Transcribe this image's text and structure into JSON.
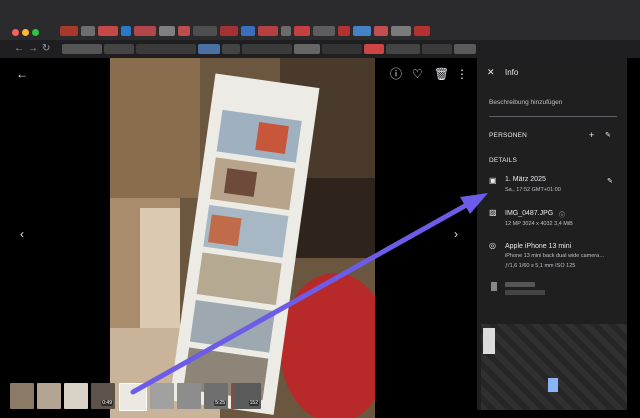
{
  "browser": {
    "nav_back": "←",
    "nav_forward": "→",
    "nav_reload": "↻"
  },
  "viewer": {
    "back_icon": "arrow-left-icon",
    "toolbar_icons": [
      "info-icon",
      "heart-icon",
      "trash-icon",
      "more-icon"
    ],
    "prev_icon": "chevron-left-icon",
    "next_icon": "chevron-right-icon",
    "thumbnails": [
      {
        "badge": ""
      },
      {
        "badge": ""
      },
      {
        "badge": ""
      },
      {
        "badge": "0:49"
      },
      {
        "badge": ""
      },
      {
        "badge": ""
      },
      {
        "badge": ""
      },
      {
        "badge": "5:25"
      },
      {
        "badge": ""
      },
      {
        "badge": "152"
      }
    ]
  },
  "info_panel": {
    "close": "✕",
    "title": "Info",
    "description_placeholder": "Beschreibung hinzufügen",
    "people_header": "PERSONEN",
    "details_header": "DETAILS",
    "date": "1. März 2025",
    "date_sub": "Sa., 17:52 GMT+01:00",
    "file_name": "IMG_0487.JPG",
    "file_sub": "12 MP   3024 x 4032   3,4 MiB",
    "camera": "Apple iPhone 13 mini",
    "camera_sub": "iPhone 13 mini back dual wide camera…",
    "camera_settings": "ƒ/1,6   1/60 s   5,1 mm   ISO 125"
  },
  "colors": {
    "arrow": "#6c5ce7",
    "panel_bg": "#1f1f1f",
    "chrome_bg": "#2b2b2e"
  }
}
